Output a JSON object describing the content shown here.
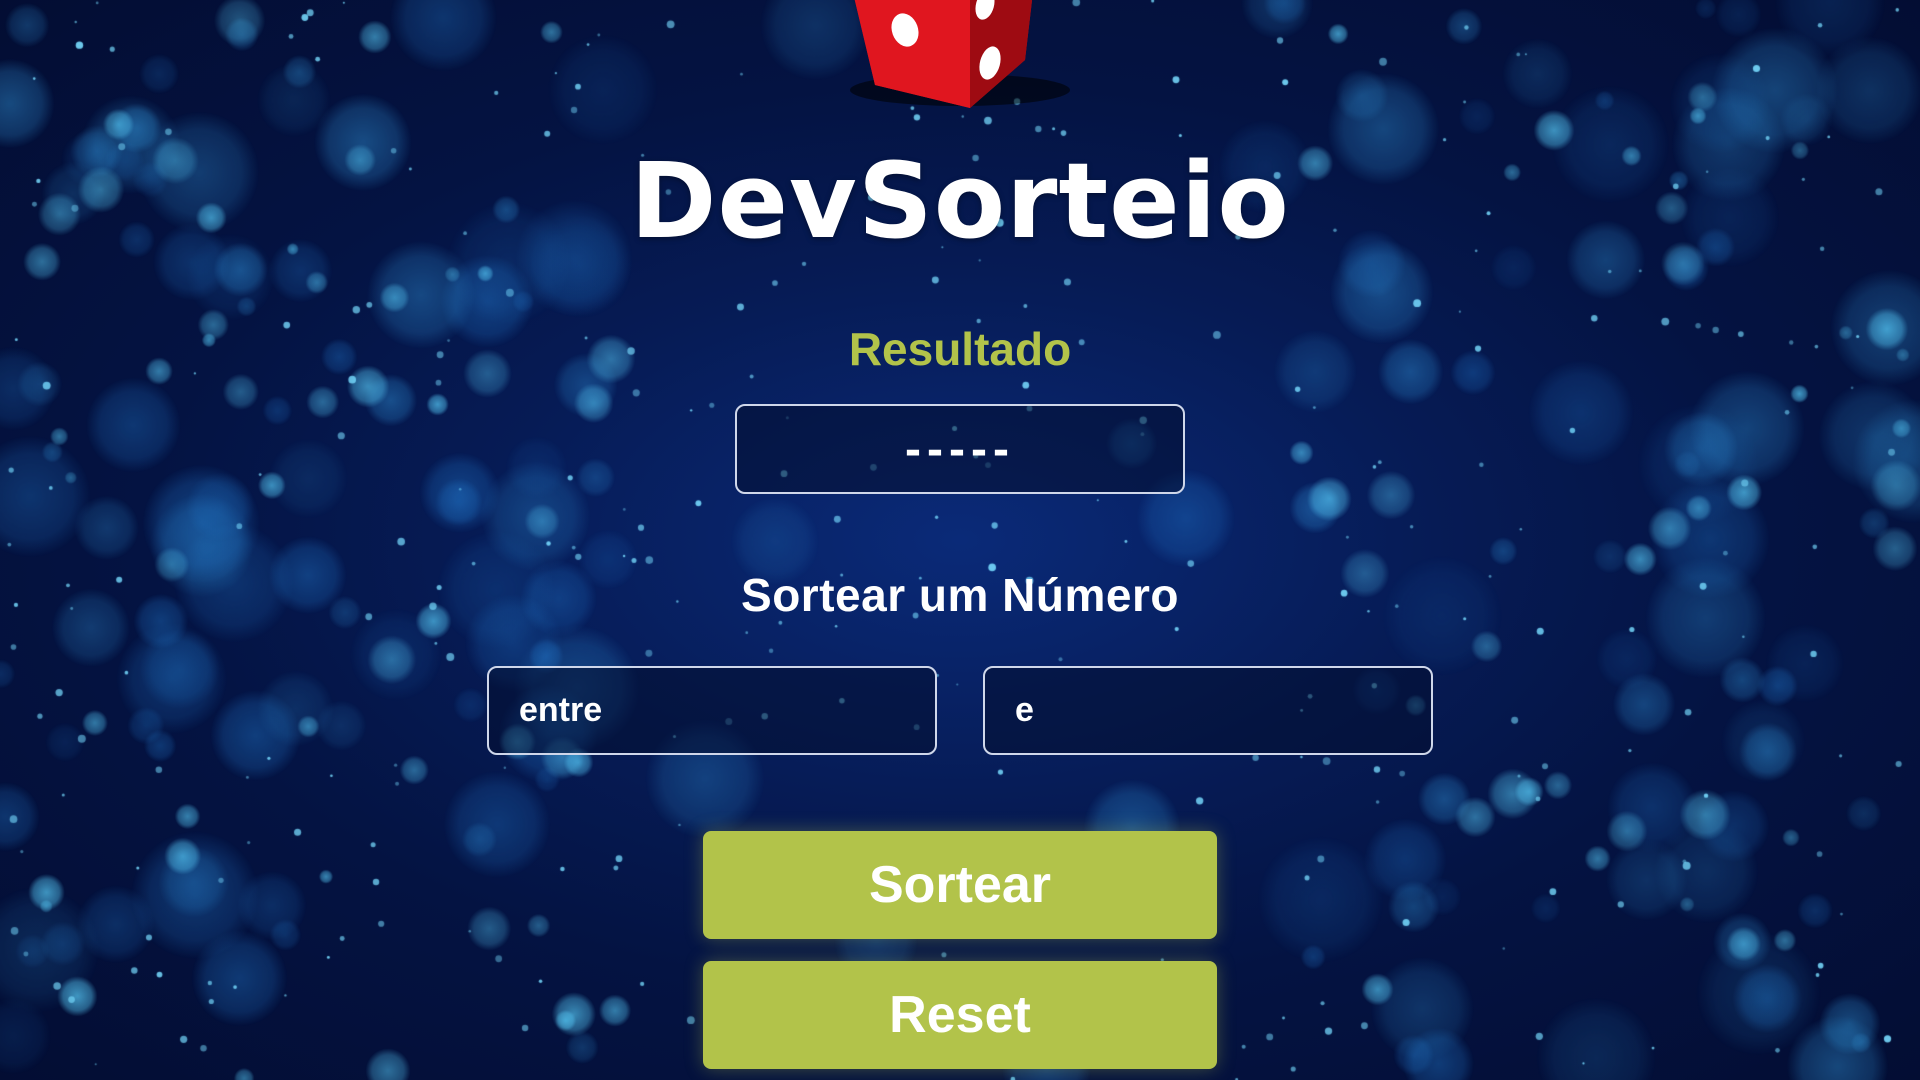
{
  "app": {
    "title": "DevSorteio",
    "logo_icon": "red-dice-icon"
  },
  "result": {
    "label": "Resultado",
    "value": "-----"
  },
  "draw_section": {
    "label": "Sortear um Número",
    "min_input": {
      "placeholder": "entre",
      "value": ""
    },
    "max_input": {
      "placeholder": "e",
      "value": ""
    }
  },
  "buttons": {
    "draw_label": "Sortear",
    "reset_label": "Reset"
  },
  "colors": {
    "accent": "#b2c34a",
    "background": "#061b55",
    "text": "#ffffff",
    "dice": "#d8121a"
  }
}
